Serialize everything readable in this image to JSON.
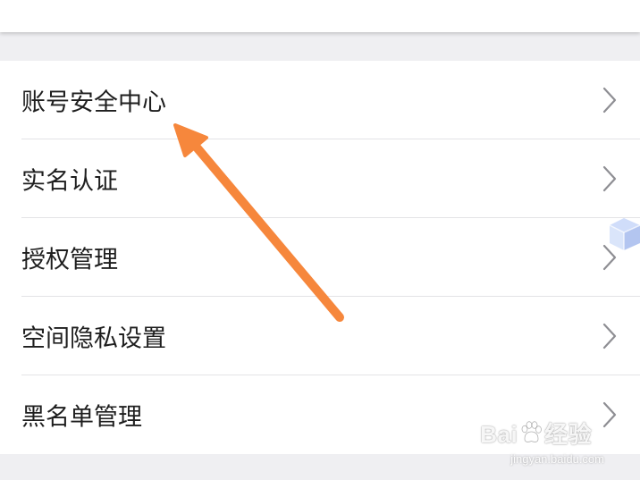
{
  "menu": {
    "items": [
      {
        "label": "账号安全中心"
      },
      {
        "label": "实名认证"
      },
      {
        "label": "授权管理"
      },
      {
        "label": "空间隐私设置"
      },
      {
        "label": "黑名单管理"
      }
    ]
  },
  "annotation": {
    "arrow_color": "#f6873c",
    "arrow_icon": "pointer-arrow-icon"
  },
  "watermark": {
    "brand_prefix": "Bai",
    "brand_suffix": "经验",
    "paw_icon": "baidu-paw-icon",
    "url": "jingyan.baidu.com"
  },
  "colors": {
    "background": "#efeff2",
    "card": "#ffffff",
    "text": "#1e1e1e",
    "chevron": "#8e8e93",
    "divider": "#e3e3e6"
  }
}
